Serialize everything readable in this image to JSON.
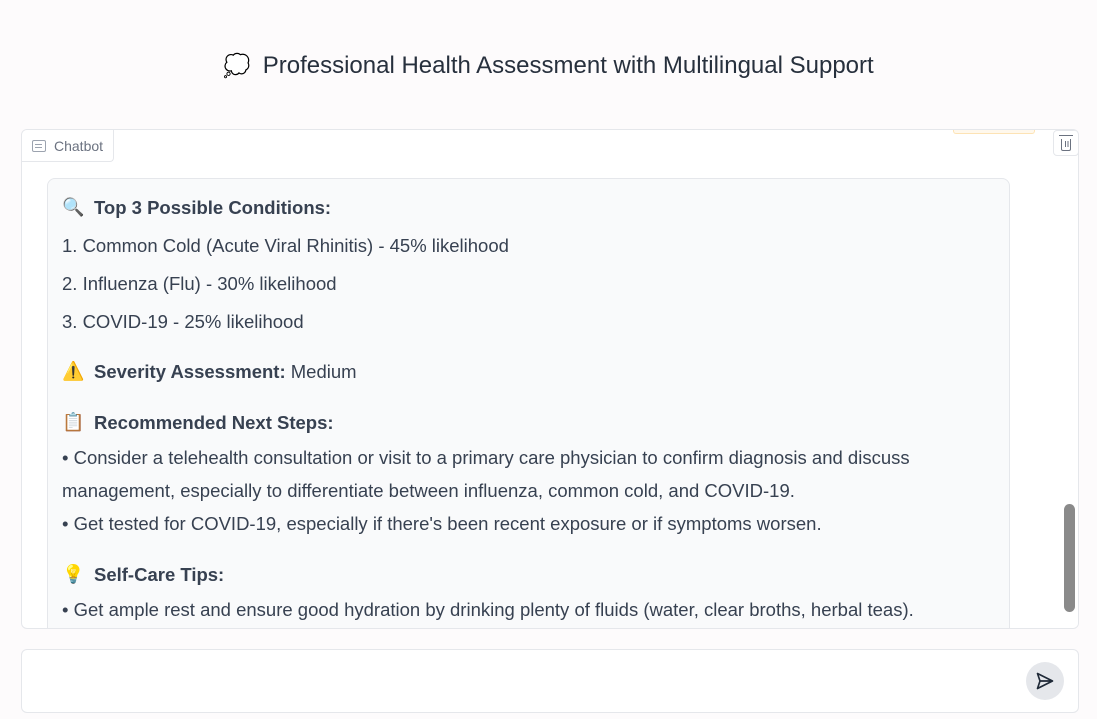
{
  "header": {
    "title": "Professional Health Assessment with Multilingual Support",
    "icon": "speech-bubble-icon"
  },
  "chatbot": {
    "label": "Chatbot",
    "message": {
      "conditions_heading": "Top 3 Possible Conditions:",
      "conditions": [
        "1. Common Cold (Acute Viral Rhinitis) - 45% likelihood",
        "2. Influenza (Flu) - 30% likelihood",
        "3. COVID-19 - 25% likelihood"
      ],
      "severity_heading": "Severity Assessment:",
      "severity_value": "Medium",
      "next_steps_heading": "Recommended Next Steps:",
      "next_steps": [
        "• Consider a telehealth consultation or visit to a primary care physician to confirm diagnosis and discuss management, especially to differentiate between influenza, common cold, and COVID-19.",
        "• Get tested for COVID-19, especially if there's been recent exposure or if symptoms worsen."
      ],
      "self_care_heading": "Self-Care Tips:",
      "self_care": [
        "• Get ample rest and ensure good hydration by drinking plenty of fluids (water, clear broths, herbal teas)."
      ]
    }
  },
  "input": {
    "value": "",
    "placeholder": ""
  },
  "icons": {
    "title": "speech-bubble-icon",
    "conditions": "magnifier-icon",
    "severity": "warning-icon",
    "next_steps": "clipboard-icon",
    "self_care": "lightbulb-icon",
    "delete": "trash-icon",
    "send": "send-icon"
  }
}
